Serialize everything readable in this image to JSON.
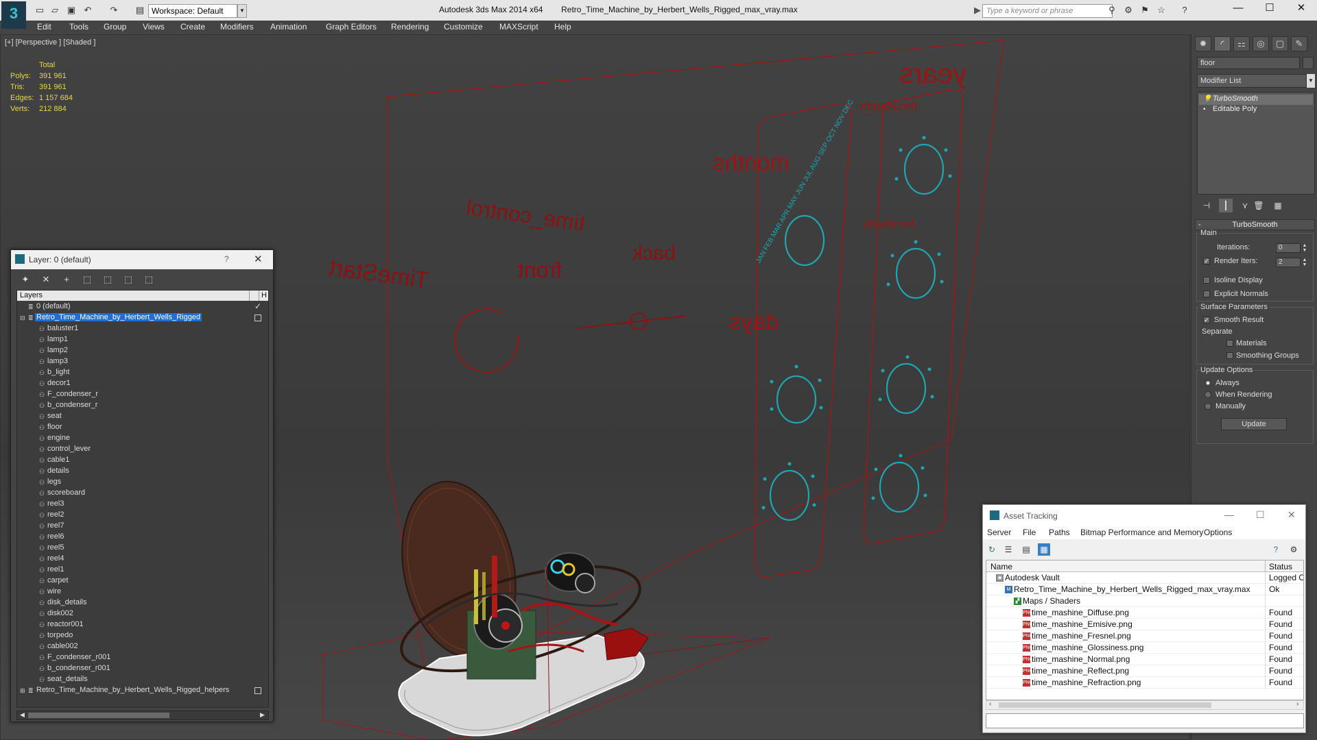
{
  "titlebar": {
    "workspace": "Workspace: Default",
    "app": "Autodesk 3ds Max  2014 x64",
    "file": "Retro_Time_Machine_by_Herbert_Wells_Rigged_max_vray.max",
    "search_placeholder": "Type a keyword or phrase"
  },
  "menu": [
    "Edit",
    "Tools",
    "Group",
    "Views",
    "Create",
    "Modifiers",
    "Animation",
    "Graph Editors",
    "Rendering",
    "Customize",
    "MAXScript",
    "Help"
  ],
  "viewport": {
    "label": "[+] [Perspective ] [Shaded ]",
    "stats_header": "Total",
    "stats": [
      {
        "k": "Polys:",
        "v": "391 961"
      },
      {
        "k": "Tris:",
        "v": "391 961"
      },
      {
        "k": "Edges:",
        "v": "1 157 684"
      },
      {
        "k": "Verts:",
        "v": "212 884"
      }
    ],
    "scene_text": {
      "years": "years",
      "thousands": "thousands",
      "hundreds": "hundreds",
      "months": "months",
      "days": "days",
      "time_control": "time_control",
      "front": "front",
      "back": "back",
      "timestart": "TimeStart",
      "months_ring": "JAN FEB MAR APR MAY JUN JUL AUG SEP OCT NOV DEC"
    },
    "colors": {
      "wire": "#b01818",
      "cyan": "#1ea6b2"
    }
  },
  "command_panel": {
    "object_name": "floor",
    "modifier_list": "Modifier List",
    "stack": [
      "TurboSmooth",
      "Editable Poly"
    ],
    "rollout": {
      "title": "TurboSmooth",
      "main": "Main",
      "iterations_label": "Iterations:",
      "iterations_value": "0",
      "render_iters_label": "Render Iters:",
      "render_iters_value": "2",
      "isoline": "Isoline Display",
      "explicit": "Explicit Normals",
      "surface_params": "Surface Parameters",
      "smooth_result": "Smooth Result",
      "separate": "Separate",
      "materials": "Materials",
      "smoothing_groups": "Smoothing Groups",
      "update_options": "Update Options",
      "always": "Always",
      "when_rendering": "When Rendering",
      "manually": "Manually",
      "update_button": "Update"
    }
  },
  "layer_dialog": {
    "title": "Layer: 0 (default)",
    "column_header": "Layers",
    "default_layer": "0 (default)",
    "main_layer": "Retro_Time_Machine_by_Herbert_Wells_Rigged",
    "children": [
      "baluster1",
      "lamp1",
      "lamp2",
      "lamp3",
      "b_light",
      "decor1",
      "F_condenser_r",
      "b_condenser_r",
      "seat",
      "floor",
      "engine",
      "control_lever",
      "cable1",
      "details",
      "legs",
      "scoreboard",
      "reel3",
      "reel2",
      "reel7",
      "reel6",
      "reel5",
      "reel4",
      "reel1",
      "carpet",
      "wire",
      "disk_details",
      "disk002",
      "reactor001",
      "torpedo",
      "cable002",
      "F_condenser_r001",
      "b_condenser_r001",
      "seat_details"
    ],
    "helpers_layer": "Retro_Time_Machine_by_Herbert_Wells_Rigged_helpers"
  },
  "asset_dialog": {
    "title": "Asset Tracking",
    "menu": [
      "Server",
      "File",
      "Paths",
      "Bitmap Performance and Memory",
      "Options"
    ],
    "col_name": "Name",
    "col_status": "Status",
    "rows": [
      {
        "name": "Autodesk Vault",
        "status": "Logged O",
        "indent": 0,
        "icon": "vault"
      },
      {
        "name": "Retro_Time_Machine_by_Herbert_Wells_Rigged_max_vray.max",
        "status": "Ok",
        "indent": 1,
        "icon": "max"
      },
      {
        "name": "Maps / Shaders",
        "status": "",
        "indent": 2,
        "icon": "maps"
      },
      {
        "name": "time_mashine_Diffuse.png",
        "status": "Found",
        "indent": 3,
        "icon": "png"
      },
      {
        "name": "time_mashine_Emisive.png",
        "status": "Found",
        "indent": 3,
        "icon": "png"
      },
      {
        "name": "time_mashine_Fresnel.png",
        "status": "Found",
        "indent": 3,
        "icon": "png"
      },
      {
        "name": "time_mashine_Glossiness.png",
        "status": "Found",
        "indent": 3,
        "icon": "png"
      },
      {
        "name": "time_mashine_Normal.png",
        "status": "Found",
        "indent": 3,
        "icon": "png"
      },
      {
        "name": "time_mashine_Reflect.png",
        "status": "Found",
        "indent": 3,
        "icon": "png"
      },
      {
        "name": "time_mashine_Refraction.png",
        "status": "Found",
        "indent": 3,
        "icon": "png"
      }
    ]
  }
}
